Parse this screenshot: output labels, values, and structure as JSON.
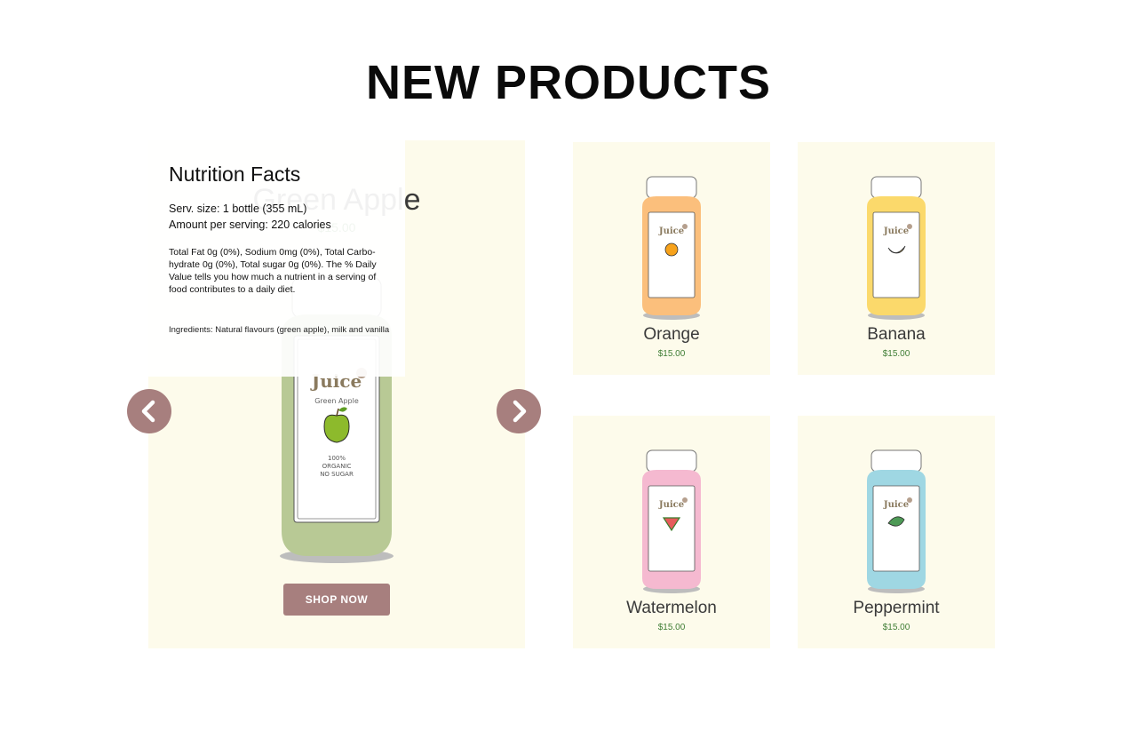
{
  "section": {
    "title": "NEW PRODUCTS"
  },
  "featured": {
    "name": "Green Apple",
    "price": "$15.00",
    "label_brand": "Juice",
    "label_flavor": "Green Apple",
    "label_line1": "100%",
    "label_line2": "ORGANIC",
    "label_line3": "NO SUGAR",
    "button_label": "SHOP NOW",
    "bottle_color": "#b8c995"
  },
  "nutrition": {
    "title": "Nutrition Facts",
    "serving_size": "Serv. size: 1 bottle (355 mL)",
    "amount": "Amount per serving: 220 calories",
    "description": "Total Fat 0g (0%), Sodium 0mg (0%), Total Carbo-hydrate 0g (0%), Total sugar 0g (0%). The % Daily Value tells you how much a nutrient in a serving of food contributes to a daily diet.",
    "ingredients": "Ingredients: Natural flavours (green apple), milk and vanilla"
  },
  "carousel": {
    "prev_icon": "chevron-left-icon",
    "next_icon": "chevron-right-icon"
  },
  "products": [
    {
      "name": "Orange",
      "price": "$15.00",
      "label_brand": "Juice",
      "color": "#fbbf7c",
      "fruit": "orange-icon"
    },
    {
      "name": "Banana",
      "price": "$15.00",
      "label_brand": "Juice",
      "color": "#fbd96b",
      "fruit": "banana-icon"
    },
    {
      "name": "Watermelon",
      "price": "$15.00",
      "label_brand": "Juice",
      "color": "#f5b9d0",
      "fruit": "watermelon-icon"
    },
    {
      "name": "Peppermint",
      "price": "$15.00",
      "label_brand": "Juice",
      "color": "#9fd7e3",
      "fruit": "mint-leaf-icon"
    }
  ],
  "colors": {
    "accent": "#a77f7e",
    "card_bg": "#fdfbeb",
    "price": "#3f7d34"
  }
}
